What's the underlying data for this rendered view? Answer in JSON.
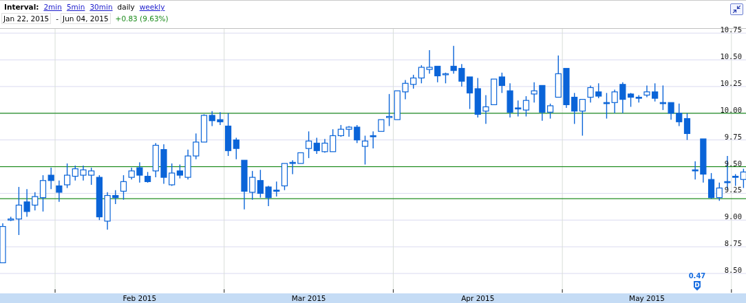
{
  "header": {
    "interval_label": "Interval:",
    "intervals": [
      {
        "label": "2min",
        "selected": false
      },
      {
        "label": "5min",
        "selected": false
      },
      {
        "label": "30min",
        "selected": false
      },
      {
        "label": "daily",
        "selected": true
      },
      {
        "label": "weekly",
        "selected": false
      }
    ],
    "start_date": "Jan 22, 2015",
    "separator": "-",
    "end_date": "Jun 04, 2015",
    "change": "+0.83 (9.63%)"
  },
  "chart": {
    "chart_data": {
      "type": "candlestick",
      "grid": true,
      "ylim": [
        8.32,
        10.79
      ],
      "categories": [
        null,
        null,
        null,
        null,
        null,
        null,
        null,
        null,
        null,
        null,
        null,
        null,
        null,
        null,
        null,
        null,
        null,
        "Feb 2015",
        null,
        null,
        null,
        null,
        null,
        null,
        null,
        null,
        null,
        null,
        null,
        null,
        null,
        null,
        null,
        null,
        null,
        null,
        null,
        null,
        "Mar 2015",
        null,
        null,
        null,
        null,
        null,
        null,
        null,
        null,
        null,
        null,
        null,
        null,
        null,
        null,
        null,
        null,
        null,
        null,
        null,
        null,
        "Apr 2015",
        null,
        null,
        null,
        null,
        null,
        null,
        null,
        null,
        null,
        null,
        null,
        null,
        null,
        null,
        null,
        null,
        null,
        null,
        null,
        null,
        "May 2015",
        null,
        null,
        null,
        null,
        null,
        null,
        null,
        null,
        null,
        null,
        null,
        null
      ],
      "yticks": [
        {
          "value": 10.75,
          "label": "10.75"
        },
        {
          "value": 10.5,
          "label": "10.50"
        },
        {
          "value": 10.25,
          "label": "10.25"
        },
        {
          "value": 10,
          "label": "10.00"
        },
        {
          "value": 9.75,
          "label": "9.75"
        },
        {
          "value": 9.5,
          "label": "9.50"
        },
        {
          "value": 9.25,
          "label": "9.25"
        },
        {
          "value": 9,
          "label": "9.00"
        },
        {
          "value": 8.75,
          "label": "8.75"
        },
        {
          "value": 8.5,
          "label": "8.50"
        }
      ],
      "series": [
        {
          "color": "#0a64d8",
          "ohlc": [
            [
              8.6,
              8.97,
              8.6,
              8.94
            ],
            [
              9.0,
              9.03,
              8.99,
              9.01
            ],
            [
              9.01,
              9.31,
              8.86,
              9.14
            ],
            [
              9.17,
              9.29,
              9.03,
              9.08
            ],
            [
              9.14,
              9.26,
              9.09,
              9.22
            ],
            [
              9.21,
              9.42,
              9.08,
              9.37
            ],
            [
              9.42,
              9.49,
              9.29,
              9.37
            ],
            [
              9.32,
              9.37,
              9.17,
              9.26
            ],
            [
              9.33,
              9.53,
              9.3,
              9.42
            ],
            [
              9.41,
              9.51,
              9.37,
              9.48
            ],
            [
              9.42,
              9.51,
              9.37,
              9.47
            ],
            [
              9.42,
              9.49,
              9.33,
              9.46
            ],
            [
              9.4,
              9.42,
              9.0,
              9.03
            ],
            [
              8.99,
              9.26,
              8.91,
              9.23
            ],
            [
              9.23,
              9.28,
              9.15,
              9.21
            ],
            [
              9.27,
              9.42,
              9.19,
              9.36
            ],
            [
              9.4,
              9.49,
              9.38,
              9.46
            ],
            [
              9.49,
              9.54,
              9.35,
              9.42
            ],
            [
              9.41,
              9.45,
              9.35,
              9.36
            ],
            [
              9.46,
              9.72,
              9.4,
              9.7
            ],
            [
              9.66,
              9.71,
              9.34,
              9.4
            ],
            [
              9.33,
              9.53,
              9.32,
              9.44
            ],
            [
              9.46,
              9.52,
              9.39,
              9.42
            ],
            [
              9.4,
              9.66,
              9.38,
              9.6
            ],
            [
              9.6,
              9.81,
              9.57,
              9.73
            ],
            [
              9.73,
              9.99,
              9.73,
              9.98
            ],
            [
              9.98,
              10.02,
              9.88,
              9.93
            ],
            [
              9.94,
              10.01,
              9.89,
              9.92
            ],
            [
              9.88,
              10.0,
              9.6,
              9.65
            ],
            [
              9.75,
              9.77,
              9.57,
              9.67
            ],
            [
              9.56,
              9.56,
              9.1,
              9.27
            ],
            [
              9.26,
              9.46,
              9.19,
              9.4
            ],
            [
              9.37,
              9.47,
              9.21,
              9.25
            ],
            [
              9.31,
              9.32,
              9.13,
              9.21
            ],
            [
              9.28,
              9.36,
              9.22,
              9.27
            ],
            [
              9.32,
              9.53,
              9.28,
              9.53
            ],
            [
              9.54,
              9.56,
              9.43,
              9.53
            ],
            [
              9.53,
              9.63,
              9.53,
              9.63
            ],
            [
              9.67,
              9.83,
              9.58,
              9.74
            ],
            [
              9.72,
              9.77,
              9.62,
              9.65
            ],
            [
              9.64,
              9.76,
              9.63,
              9.72
            ],
            [
              9.64,
              9.85,
              9.64,
              9.79
            ],
            [
              9.79,
              9.89,
              9.78,
              9.85
            ],
            [
              9.85,
              9.88,
              9.78,
              9.87
            ],
            [
              9.87,
              9.89,
              9.72,
              9.75
            ],
            [
              9.69,
              9.79,
              9.52,
              9.74
            ],
            [
              9.79,
              9.83,
              9.67,
              9.78
            ],
            [
              9.83,
              9.94,
              9.83,
              9.94
            ],
            [
              9.96,
              10.18,
              9.88,
              9.97
            ],
            [
              9.94,
              10.21,
              9.94,
              10.21
            ],
            [
              10.2,
              10.31,
              10.13,
              10.28
            ],
            [
              10.27,
              10.36,
              10.23,
              10.33
            ],
            [
              10.33,
              10.45,
              10.28,
              10.43
            ],
            [
              10.41,
              10.59,
              10.37,
              10.43
            ],
            [
              10.44,
              10.44,
              10.29,
              10.35
            ],
            [
              10.36,
              10.38,
              10.28,
              10.37
            ],
            [
              10.44,
              10.63,
              10.37,
              10.4
            ],
            [
              10.42,
              10.46,
              10.25,
              10.3
            ],
            [
              10.34,
              10.34,
              10.04,
              10.19
            ],
            [
              10.23,
              10.33,
              9.96,
              9.99
            ],
            [
              10.02,
              10.17,
              9.9,
              10.06
            ],
            [
              10.08,
              10.32,
              10.08,
              10.32
            ],
            [
              10.34,
              10.38,
              10.19,
              10.26
            ],
            [
              10.21,
              10.28,
              9.96,
              10.01
            ],
            [
              10.05,
              10.12,
              9.97,
              10.04
            ],
            [
              10.03,
              10.16,
              9.97,
              10.12
            ],
            [
              10.18,
              10.29,
              10.1,
              10.21
            ],
            [
              10.26,
              10.26,
              9.93,
              10.01
            ],
            [
              10.01,
              10.09,
              9.95,
              10.07
            ],
            [
              10.15,
              10.54,
              10.15,
              10.37
            ],
            [
              10.42,
              10.42,
              10.05,
              10.08
            ],
            [
              10.15,
              10.19,
              9.9,
              10.02
            ],
            [
              10.02,
              10.13,
              9.79,
              10.13
            ],
            [
              10.15,
              10.26,
              10.1,
              10.24
            ],
            [
              10.2,
              10.28,
              10.14,
              10.16
            ],
            [
              10.1,
              10.19,
              9.95,
              10.09
            ],
            [
              10.1,
              10.22,
              10.0,
              10.2
            ],
            [
              10.27,
              10.29,
              10.0,
              10.13
            ],
            [
              10.18,
              10.19,
              10.06,
              10.15
            ],
            [
              10.15,
              10.17,
              10.1,
              10.14
            ],
            [
              10.17,
              10.26,
              10.15,
              10.2
            ],
            [
              10.2,
              10.28,
              10.11,
              10.14
            ],
            [
              10.1,
              10.26,
              10.03,
              10.09
            ],
            [
              10.1,
              10.1,
              9.94,
              10.0
            ],
            [
              10.0,
              10.09,
              9.88,
              9.92
            ],
            [
              9.95,
              10.0,
              9.75,
              9.81
            ],
            [
              9.47,
              9.55,
              9.38,
              9.46
            ],
            [
              9.76,
              9.76,
              9.35,
              9.43
            ],
            [
              9.38,
              9.44,
              9.2,
              9.21
            ],
            [
              9.21,
              9.35,
              9.18,
              9.3
            ],
            [
              9.36,
              9.6,
              9.29,
              9.35
            ],
            [
              9.41,
              9.43,
              9.32,
              9.4
            ],
            [
              9.38,
              9.48,
              9.3,
              9.45
            ]
          ]
        }
      ],
      "ref_lines": [
        {
          "axis": "y",
          "value": 10.0
        },
        {
          "axis": "y",
          "value": 9.5
        },
        {
          "axis": "y",
          "value": 9.2
        }
      ],
      "annotations": [
        "0.47",
        "D"
      ]
    }
  }
}
